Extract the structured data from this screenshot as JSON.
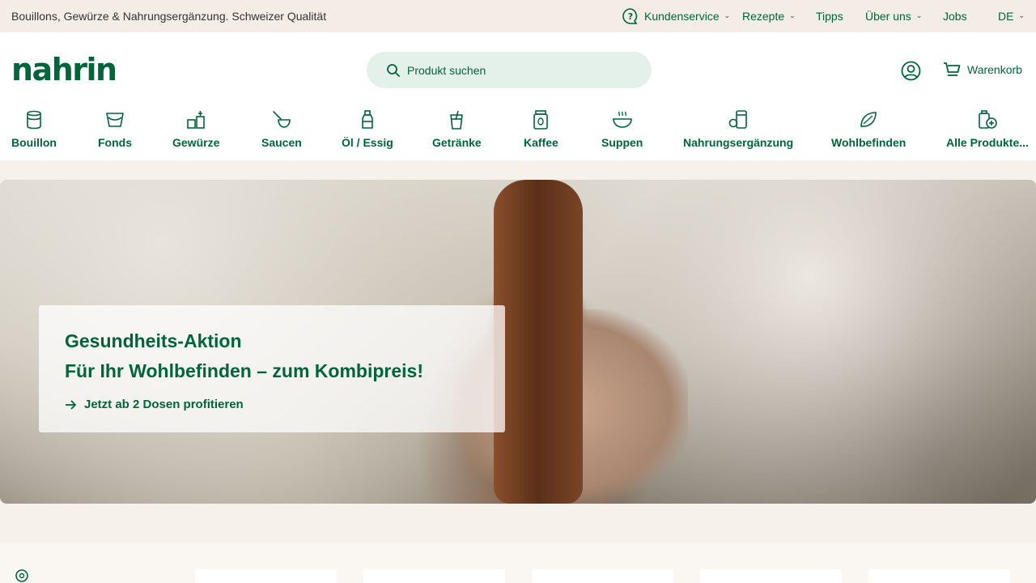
{
  "topbar": {
    "tagline": "Bouillons, Gewürze & Nahrungsergänzung. Schweizer Qualität",
    "customer_service": "Kundenservice",
    "recipes": "Rezepte",
    "tips": "Tipps",
    "about": "Über uns",
    "jobs": "Jobs",
    "language": "DE"
  },
  "header": {
    "logo": "nahrin",
    "search_placeholder": "Produkt suchen",
    "cart_label": "Warenkorb"
  },
  "categories": [
    {
      "label": "Bouillon",
      "icon": "bouillon-icon"
    },
    {
      "label": "Fonds",
      "icon": "fonds-icon"
    },
    {
      "label": "Gewürze",
      "icon": "spice-icon"
    },
    {
      "label": "Saucen",
      "icon": "sauce-icon"
    },
    {
      "label": "Öl / Essig",
      "icon": "oil-bottle-icon"
    },
    {
      "label": "Getränke",
      "icon": "drink-icon"
    },
    {
      "label": "Kaffee",
      "icon": "coffee-icon"
    },
    {
      "label": "Suppen",
      "icon": "soup-icon"
    },
    {
      "label": "Nahrungsergänzung",
      "icon": "supplement-icon"
    },
    {
      "label": "Wohlbefinden",
      "icon": "wellbeing-icon"
    },
    {
      "label": "Alle Produkte...",
      "icon": "all-products-icon"
    }
  ],
  "hero": {
    "title_line1": "Gesundheits-Aktion",
    "title_line2": "Für Ihr Wohlbefinden – zum Kombipreis!",
    "cta": "Jetzt ab 2 Dosen profitieren"
  },
  "colors": {
    "brand_green": "#00653a",
    "search_bg": "#e4f0ea",
    "topbar_bg": "#f4ede5"
  }
}
